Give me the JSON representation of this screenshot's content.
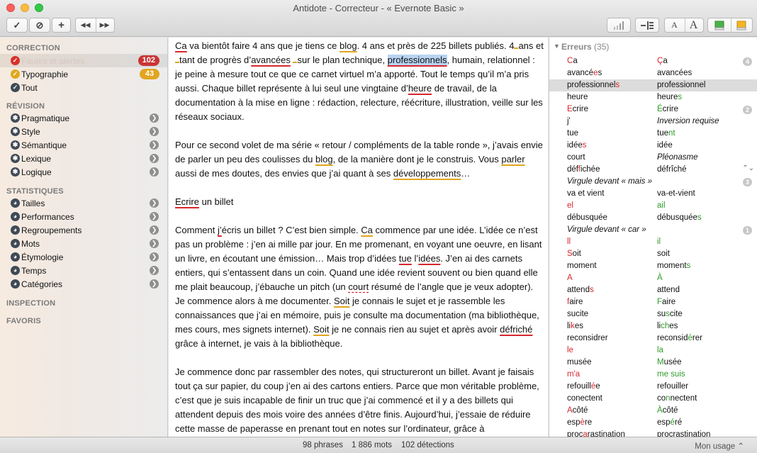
{
  "window": {
    "title": "Antidote - Correcteur - « Evernote Basic »"
  },
  "toolbar": {
    "check": "✓",
    "block": "⊘",
    "add": "+",
    "prev": "◀◀",
    "next": "▶▶",
    "font_small": "A",
    "font_big": "A"
  },
  "sidebar": {
    "correction": {
      "title": "CORRECTION",
      "items": [
        {
          "label": "Fautes et alertes",
          "badge": "102",
          "icon": "error-icon",
          "selected": true
        },
        {
          "label": "Typographie",
          "badge": "43",
          "icon": "typography-icon"
        },
        {
          "label": "Tout",
          "icon": "check-icon"
        }
      ]
    },
    "revision": {
      "title": "RÉVISION",
      "items": [
        {
          "label": "Pragmatique"
        },
        {
          "label": "Style"
        },
        {
          "label": "Sémantique"
        },
        {
          "label": "Lexique"
        },
        {
          "label": "Logique"
        }
      ]
    },
    "statistiques": {
      "title": "STATISTIQUES",
      "items": [
        {
          "label": "Tailles"
        },
        {
          "label": "Performances"
        },
        {
          "label": "Regroupements"
        },
        {
          "label": "Mots"
        },
        {
          "label": "Étymologie"
        },
        {
          "label": "Temps"
        },
        {
          "label": "Catégories"
        }
      ]
    },
    "inspection": {
      "title": "INSPECTION"
    },
    "favoris": {
      "title": "FAVORIS"
    }
  },
  "errors_panel": {
    "title": "Erreurs",
    "count": "(35)",
    "rows": [
      {
        "orig": [
          [
            "r",
            "C"
          ],
          [
            "",
            "a"
          ]
        ],
        "sugg": [
          [
            "r",
            "Ç"
          ],
          [
            "",
            "a"
          ]
        ],
        "count": "4"
      },
      {
        "orig": [
          [
            "",
            "avancé"
          ],
          [
            "r",
            "e"
          ],
          [
            "",
            "s"
          ]
        ],
        "sugg": [
          [
            "",
            "avancées"
          ]
        ]
      },
      {
        "orig": [
          [
            "",
            "professionnel"
          ],
          [
            "r",
            "s"
          ]
        ],
        "sugg": [
          [
            "",
            "professionnel"
          ]
        ],
        "selected": true
      },
      {
        "orig": [
          [
            "",
            "heure"
          ]
        ],
        "sugg": [
          [
            "",
            "heure"
          ],
          [
            "g",
            "s"
          ]
        ]
      },
      {
        "orig": [
          [
            "r",
            "E"
          ],
          [
            "",
            "crire"
          ]
        ],
        "sugg": [
          [
            "g",
            "É"
          ],
          [
            "",
            "crire"
          ]
        ],
        "count": "2"
      },
      {
        "orig": [
          [
            "",
            "j'"
          ]
        ],
        "sugg": [
          [
            "",
            "Inversion requise"
          ]
        ],
        "sugg_italic": true
      },
      {
        "orig": [
          [
            "",
            "tue"
          ]
        ],
        "sugg": [
          [
            "",
            "tue"
          ],
          [
            "g",
            "nt"
          ]
        ]
      },
      {
        "orig": [
          [
            "",
            "idée"
          ],
          [
            "r",
            "s"
          ]
        ],
        "sugg": [
          [
            "",
            "idée"
          ]
        ]
      },
      {
        "orig": [
          [
            "",
            "court"
          ]
        ],
        "sugg": [
          [
            "",
            "Pléonasme"
          ]
        ],
        "sugg_italic": true
      },
      {
        "orig": [
          [
            "",
            "déf"
          ],
          [
            "r",
            "f"
          ],
          [
            "",
            "ichée"
          ]
        ],
        "sugg": [
          [
            "",
            "défrîché"
          ]
        ],
        "updown": "⌃⌄"
      },
      {
        "orig": [
          [
            "",
            "Virgule devant « mais »"
          ]
        ],
        "header": true,
        "count": "3"
      },
      {
        "orig": [
          [
            "",
            "va et vient"
          ]
        ],
        "sugg": [
          [
            "",
            "va-et-vient"
          ]
        ]
      },
      {
        "orig": [
          [
            "r",
            "el"
          ]
        ],
        "sugg": [
          [
            "g",
            "ail"
          ]
        ]
      },
      {
        "orig": [
          [
            "",
            "débusquée"
          ]
        ],
        "sugg": [
          [
            "",
            "débusquée"
          ],
          [
            "g",
            "s"
          ]
        ]
      },
      {
        "orig": [
          [
            "",
            "Virgule devant « car »"
          ]
        ],
        "header": true,
        "count": "1"
      },
      {
        "orig": [
          [
            "r",
            "ll"
          ]
        ],
        "sugg": [
          [
            "g",
            "il"
          ]
        ]
      },
      {
        "orig": [
          [
            "r",
            "S"
          ],
          [
            "",
            "oit"
          ]
        ],
        "sugg": [
          [
            "",
            "soit"
          ]
        ]
      },
      {
        "orig": [
          [
            "",
            "moment"
          ]
        ],
        "sugg": [
          [
            "",
            "moment"
          ],
          [
            "g",
            "s"
          ]
        ]
      },
      {
        "orig": [
          [
            "r",
            "A"
          ]
        ],
        "sugg": [
          [
            "g",
            "À"
          ]
        ]
      },
      {
        "orig": [
          [
            "",
            "attend"
          ],
          [
            "r",
            "s"
          ]
        ],
        "sugg": [
          [
            "",
            "attend"
          ]
        ]
      },
      {
        "orig": [
          [
            "r",
            "f"
          ],
          [
            "",
            "aire"
          ]
        ],
        "sugg": [
          [
            "g",
            "F"
          ],
          [
            "",
            "aire"
          ]
        ]
      },
      {
        "orig": [
          [
            "",
            "sucite"
          ]
        ],
        "sugg": [
          [
            "",
            "su"
          ],
          [
            "g",
            "s"
          ],
          [
            "",
            "cite"
          ]
        ]
      },
      {
        "orig": [
          [
            "",
            "li"
          ],
          [
            "r",
            "k"
          ],
          [
            "",
            "es"
          ]
        ],
        "sugg": [
          [
            "",
            "li"
          ],
          [
            "g",
            "ch"
          ],
          [
            "",
            "es"
          ]
        ]
      },
      {
        "orig": [
          [
            "",
            "reconsidrer"
          ]
        ],
        "sugg": [
          [
            "",
            "reconsid"
          ],
          [
            "g",
            "é"
          ],
          [
            "",
            "rer"
          ]
        ]
      },
      {
        "orig": [
          [
            "r",
            "le"
          ]
        ],
        "sugg": [
          [
            "g",
            "la"
          ]
        ]
      },
      {
        "orig": [
          [
            "",
            "musée"
          ]
        ],
        "sugg": [
          [
            "g",
            "M"
          ],
          [
            "",
            "usée"
          ]
        ]
      },
      {
        "orig": [
          [
            "r",
            "m'a"
          ]
        ],
        "sugg": [
          [
            "g",
            "me suis"
          ]
        ]
      },
      {
        "orig": [
          [
            "",
            "refouill"
          ],
          [
            "r",
            "é"
          ],
          [
            "",
            "e"
          ]
        ],
        "sugg": [
          [
            "",
            "refouiller"
          ]
        ]
      },
      {
        "orig": [
          [
            "",
            "conectent"
          ]
        ],
        "sugg": [
          [
            "",
            "co"
          ],
          [
            "g",
            "n"
          ],
          [
            "",
            "nectent"
          ]
        ]
      },
      {
        "orig": [
          [
            "r",
            "A"
          ],
          [
            "",
            ""
          ],
          [
            "",
            ""
          ],
          [
            "",
            ""
          ],
          [
            "",
            ""
          ],
          [
            "",
            "côté"
          ]
        ],
        "sugg": [
          [
            "g",
            "À"
          ],
          [
            "",
            "côté"
          ]
        ]
      },
      {
        "orig": [
          [
            "",
            "esp"
          ],
          [
            "r",
            "è"
          ],
          [
            "",
            "re"
          ]
        ],
        "sugg": [
          [
            "",
            "esp"
          ],
          [
            "g",
            "é"
          ],
          [
            "",
            "ré"
          ]
        ]
      },
      {
        "orig": [
          [
            "",
            "proc"
          ],
          [
            "r",
            "a"
          ],
          [
            "",
            "rastination"
          ]
        ],
        "sugg": [
          [
            "",
            "procrastination"
          ]
        ]
      }
    ]
  },
  "status": {
    "phrases": "98 phrases",
    "mots": "1 886 mots",
    "detections": "102 détections",
    "usage": "Mon usage"
  }
}
